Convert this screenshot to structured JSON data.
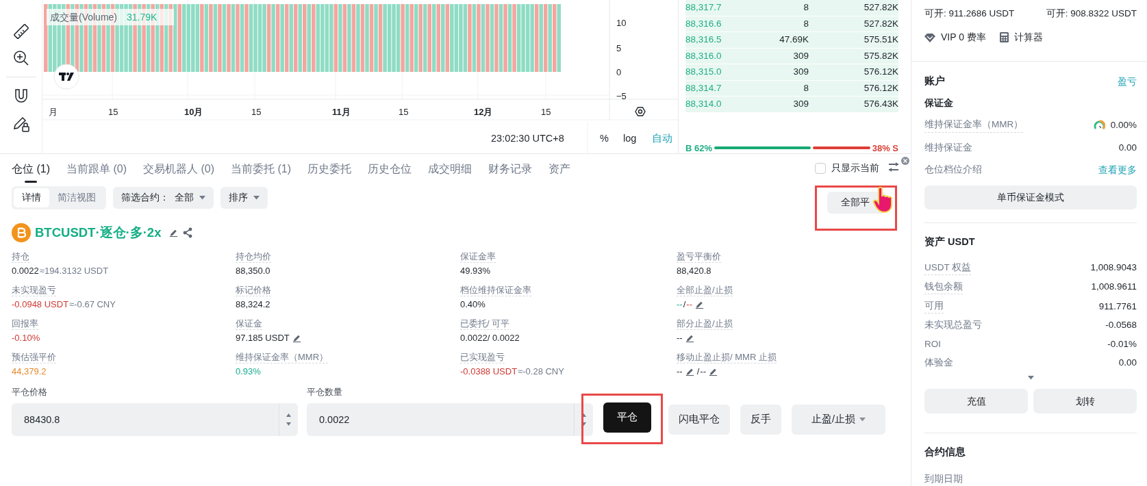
{
  "chart": {
    "legend_label": "成交量(Volume)",
    "legend_value": "31.79K",
    "y_labels": [
      "10",
      "5",
      "0",
      "−5"
    ],
    "x_labels": [
      {
        "text": "月",
        "major": false
      },
      {
        "text": "15",
        "major": false
      },
      {
        "text": "10月",
        "major": true
      },
      {
        "text": "15",
        "major": false
      },
      {
        "text": "11月",
        "major": true
      },
      {
        "text": "15",
        "major": false
      },
      {
        "text": "12月",
        "major": true
      },
      {
        "text": "15",
        "major": false
      }
    ],
    "time": "23:02:30 UTC+8",
    "scale_buttons": [
      {
        "label": "%",
        "selected": false
      },
      {
        "label": "log",
        "selected": false
      },
      {
        "label": "自动",
        "selected": true
      }
    ]
  },
  "order_book": {
    "rows": [
      {
        "price": "88,317.7",
        "amount": "8",
        "total": "527.82K"
      },
      {
        "price": "88,316.6",
        "amount": "8",
        "total": "527.82K"
      },
      {
        "price": "88,316.5",
        "amount": "47.69K",
        "total": "575.51K"
      },
      {
        "price": "88,316.0",
        "amount": "309",
        "total": "575.82K"
      },
      {
        "price": "88,315.0",
        "amount": "309",
        "total": "576.12K"
      },
      {
        "price": "88,314.7",
        "amount": "8",
        "total": "576.12K"
      },
      {
        "price": "88,314.0",
        "amount": "309",
        "total": "576.43K"
      }
    ],
    "ratio": {
      "buy": "B 62%",
      "sell": "38% S",
      "level": 0.62
    }
  },
  "positions": {
    "tabs": [
      {
        "label": "仓位 (1)",
        "selected": true
      },
      {
        "label": "当前跟单 (0)",
        "selected": false
      },
      {
        "label": "交易机器人 (0)",
        "selected": false
      },
      {
        "label": "当前委托 (1)",
        "selected": false
      },
      {
        "label": "历史委托",
        "selected": false
      },
      {
        "label": "历史仓位",
        "selected": false
      },
      {
        "label": "成交明细",
        "selected": false
      },
      {
        "label": "财务记录",
        "selected": false
      },
      {
        "label": "资产",
        "selected": false
      }
    ],
    "only_current": {
      "label": "只显示当前",
      "checked": false
    },
    "view_toggle": [
      {
        "label": "详情",
        "selected": true
      },
      {
        "label": "简洁视图",
        "selected": false
      }
    ],
    "filter": {
      "label": "筛选合约：",
      "value": "全部"
    },
    "sort": "排序",
    "close_all": {
      "label": "全部平",
      "highlighted": true
    },
    "symbol": "BTCUSDT·逐仓·多·2x",
    "columns": [
      [
        {
          "label": "持仓",
          "parts": [
            {
              "kind": "plain",
              "text": "0.0022"
            },
            {
              "kind": "muted",
              "text": "≈194.3132 USDT"
            }
          ]
        },
        {
          "label": "未实现盈亏",
          "parts": [
            {
              "kind": "loss",
              "text": "-0.0948 USDT"
            },
            {
              "kind": "muted",
              "text": "≈-0.67 CNY"
            }
          ]
        },
        {
          "label": "回报率",
          "parts": [
            {
              "kind": "loss",
              "text": "-0.10%"
            }
          ]
        },
        {
          "label": "预估强平价",
          "parts": [
            {
              "kind": "warn",
              "text": "44,379.2"
            }
          ]
        }
      ],
      [
        {
          "label": "持仓均价",
          "parts": [
            {
              "kind": "plain",
              "text": "88,350.0"
            }
          ]
        },
        {
          "label": "标记价格",
          "parts": [
            {
              "kind": "plain",
              "text": "88,324.2"
            }
          ]
        },
        {
          "label": "保证金",
          "parts": [
            {
              "kind": "plain",
              "text": "97.185 USDT"
            },
            {
              "kind": "edit"
            }
          ]
        },
        {
          "label": "维持保证金率（MMR）",
          "parts": [
            {
              "kind": "profit",
              "text": "0.93%"
            }
          ]
        }
      ],
      [
        {
          "label": "保证金率",
          "parts": [
            {
              "kind": "plain",
              "text": "49.93%"
            }
          ]
        },
        {
          "label": "档位维持保证金率",
          "parts": [
            {
              "kind": "plain",
              "text": "0.40%"
            }
          ]
        },
        {
          "label": "已委托/ 可平",
          "parts": [
            {
              "kind": "plain",
              "text": "0.0022/ 0.0022"
            }
          ]
        },
        {
          "label": "已实现盈亏",
          "parts": [
            {
              "kind": "loss",
              "text": "-0.0388 USDT"
            },
            {
              "kind": "muted",
              "text": "≈-0.28 CNY"
            }
          ]
        }
      ],
      [
        {
          "label": "盈亏平衡价",
          "parts": [
            {
              "kind": "plain",
              "text": "88,420.8"
            }
          ]
        },
        {
          "label": "全部止盈/止损",
          "parts": [
            {
              "kind": "profit",
              "text": "--"
            },
            {
              "kind": "plain",
              "text": "/"
            },
            {
              "kind": "loss",
              "text": "--"
            },
            {
              "kind": "edit"
            }
          ]
        },
        {
          "label": "部分止盈/止损",
          "parts": [
            {
              "kind": "plain",
              "text": "--"
            },
            {
              "kind": "edit"
            }
          ]
        },
        {
          "label": "移动止盈止损/ MMR 止损",
          "parts": [
            {
              "kind": "plain",
              "text": "--"
            },
            {
              "kind": "edit"
            },
            {
              "kind": "plain",
              "text": "/"
            },
            {
              "kind": "plain",
              "text": "--"
            },
            {
              "kind": "edit"
            }
          ]
        }
      ]
    ],
    "close_form": {
      "price_label": "平仓价格",
      "price_value": "88430.8",
      "qty_label": "平仓数量",
      "qty_value": "0.0022",
      "buttons": [
        {
          "label": "平仓",
          "kind": "primary",
          "highlighted": true
        },
        {
          "label": "闪电平仓",
          "kind": "secondary",
          "highlighted": false
        },
        {
          "label": "反手",
          "kind": "secondary",
          "highlighted": false
        },
        {
          "label": "止盈/止损",
          "kind": "dropdown",
          "highlighted": false
        }
      ]
    }
  },
  "side": {
    "available": [
      "可开: 911.2686 USDT",
      "可开: 908.8322 USDT"
    ],
    "links": [
      {
        "label": "VIP 0 费率",
        "kind": "vip"
      },
      {
        "label": "计算器",
        "kind": "calculator"
      }
    ],
    "account": {
      "title": "账户",
      "link": "盈亏",
      "margin_title": "保证金",
      "rows": [
        {
          "label": "维持保证金率（MMR）",
          "value": "0.00%",
          "kind": "gauge"
        },
        {
          "label": "维持保证金",
          "value": "0.00",
          "kind": "plain"
        },
        {
          "label": "仓位档位介绍",
          "value": "查看更多",
          "kind": "link"
        }
      ],
      "mode_button": "单币保证金模式"
    },
    "assets": {
      "title": "资产 USDT",
      "rows": [
        {
          "label": "USDT 权益",
          "value": "1,008.9043"
        },
        {
          "label": "钱包余额",
          "value": "1,008.9611"
        },
        {
          "label": "可用",
          "value": "911.7761"
        },
        {
          "label": "未实现总盈亏",
          "value": "-0.0568"
        },
        {
          "label": "ROI",
          "value": "-0.01%"
        },
        {
          "label": "体验金",
          "value": "0.00"
        }
      ],
      "buttons": [
        "充值",
        "划转"
      ]
    },
    "contract": {
      "title": "合约信息",
      "rows": [
        "到期日期"
      ]
    }
  }
}
